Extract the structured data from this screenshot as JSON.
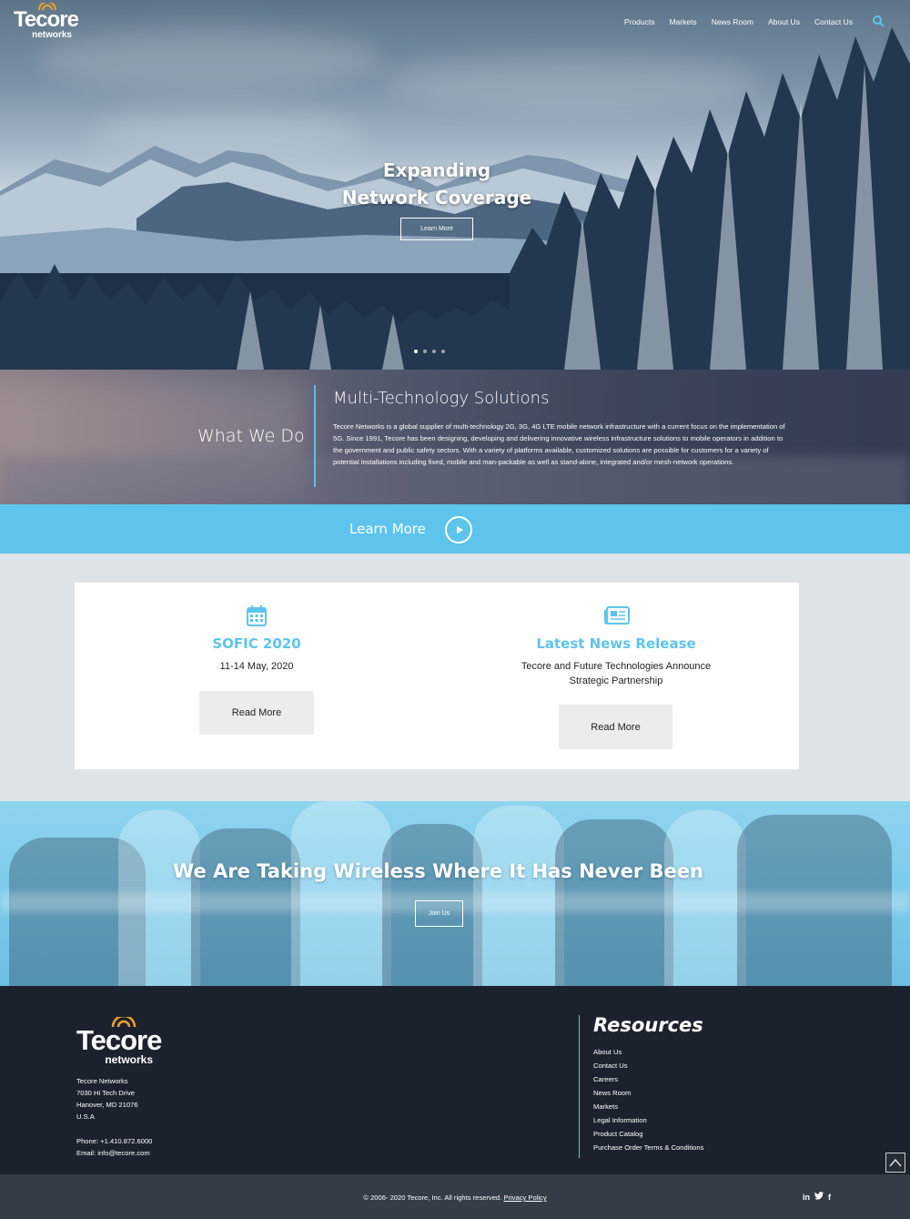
{
  "brand": {
    "name": "Tecore",
    "tagline": "networks",
    "accent": "#5ec4eb",
    "logo_arc": "#f0a22c"
  },
  "nav": {
    "items": [
      "Products",
      "Markets",
      "News Room",
      "About Us",
      "Contact Us"
    ],
    "search_icon": "search-icon"
  },
  "hero": {
    "title_line1": "Expanding",
    "title_line2": "Network Coverage",
    "button": "Learn More",
    "slides": 4,
    "active_slide": 1
  },
  "what_we_do": {
    "label": "What We Do",
    "title": "Multi-Technology Solutions",
    "body": "Tecore Networks is a global supplier of multi-technology 2G, 3G, 4G LTE mobile network infrastructure with a current focus on the implementation of 5G. Since 1991, Tecore has been designing, developing and delivering innovative wireless infrastructure solutions to mobile operators in addition to the government and public safety sectors. With a variety of platforms available, customized solutions are possible for customers for a variety of potential installations including fixed, mobile and man-packable as well as stand-alone, integrated and/or mesh-network operations."
  },
  "learn_more_bar": {
    "label": "Learn More"
  },
  "events": {
    "event": {
      "icon": "calendar-icon",
      "title": "SOFIC 2020",
      "subtitle": "11-14 May, 2020",
      "button": "Read More"
    },
    "news": {
      "icon": "newspaper-icon",
      "title": "Latest News Release",
      "subtitle_line1": "Tecore and Future Technologies Announce",
      "subtitle_line2": "Strategic Partnership",
      "button": "Read More"
    }
  },
  "team": {
    "title": "We Are Taking Wireless Where It Has Never Been",
    "button": "Join Us"
  },
  "footer": {
    "company": "Tecore Networks",
    "street": "7030 Hi Tech Drive",
    "city": "Hanover, MD 21076",
    "country": "U.S.A",
    "phone": "Phone: +1.410.872.6000",
    "email_label": "Email: ",
    "email": "info@tecore.com",
    "resources_title": "Resources",
    "resources": [
      "About Us",
      "Contact Us",
      "Careers",
      "News Room",
      "Markets",
      "Legal Information",
      "Product Catalog",
      "Purchase Order Terms & Conditions"
    ],
    "copyright": "© 2006- 2020 Tecore, Inc. All rights reserved.",
    "privacy": "Privacy Policy",
    "social": [
      "in",
      "twitter-icon",
      "f"
    ]
  }
}
